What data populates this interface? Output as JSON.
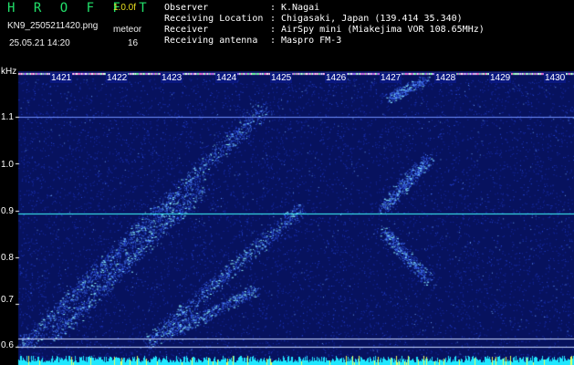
{
  "header": {
    "app_title": "H R O F F T",
    "version": "1.0.0f",
    "filename": "KN9_2505211420.png",
    "datetime": "25.05.21 14:20",
    "meteor_label": "meteor",
    "meteor_count": "16"
  },
  "station": [
    {
      "label": "Observer",
      "value": "K.Nagai"
    },
    {
      "label": "Receiving Location",
      "value": "Chigasaki, Japan (139.414 35.340)"
    },
    {
      "label": "Receiver",
      "value": "AirSpy mini (Miakejima VOR 108.65MHz)"
    },
    {
      "label": "Receiving antenna",
      "value": "Maspro FM-3"
    }
  ],
  "colon": ":",
  "y_axis": {
    "unit": "kHz",
    "ticks": [
      "1.1",
      "1.0",
      "0.9",
      "0.8",
      "0.7",
      "0.6"
    ]
  },
  "minutes": [
    "1421",
    "1422",
    "1423",
    "1424",
    "1425",
    "1426",
    "1427",
    "1428",
    "1429",
    "1430"
  ],
  "colors": {
    "background": "#07125e",
    "noise": "#2340d8",
    "trail": "#8ff7ff",
    "carrier": "#40ffff",
    "header_green": "#22e06a",
    "header_yellow": "#e8e020"
  }
}
